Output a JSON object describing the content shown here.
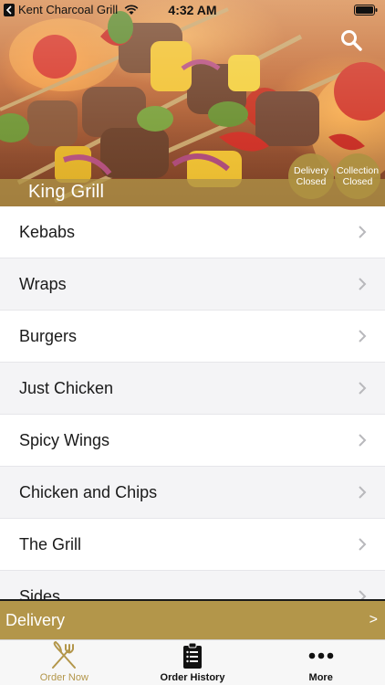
{
  "status_bar": {
    "back_app": "Kent Charcoal Grill",
    "time": "4:32 AM"
  },
  "header": {
    "restaurant_name": "King Grill",
    "badges": [
      {
        "line1": "Delivery",
        "line2": "Closed"
      },
      {
        "line1": "Collection",
        "line2": "Closed"
      }
    ],
    "icons": [
      "search-icon",
      "wifi-icon",
      "battery-icon"
    ]
  },
  "categories": [
    "Kebabs",
    "Wraps",
    "Burgers",
    "Just Chicken",
    "Spicy Wings",
    "Chicken and Chips",
    "The Grill",
    "Sides"
  ],
  "order_mode": {
    "label": "Delivery",
    "arrow": ">"
  },
  "tabs": [
    {
      "label": "Order Now",
      "icon": "fork-knife-icon",
      "active": true
    },
    {
      "label": "Order History",
      "icon": "clipboard-icon",
      "active": false
    },
    {
      "label": "More",
      "icon": "more-dots-icon",
      "active": false
    }
  ],
  "colors": {
    "accent": "#b3964a",
    "badge": "#ad9142",
    "row_alt": "#f4f4f6"
  }
}
